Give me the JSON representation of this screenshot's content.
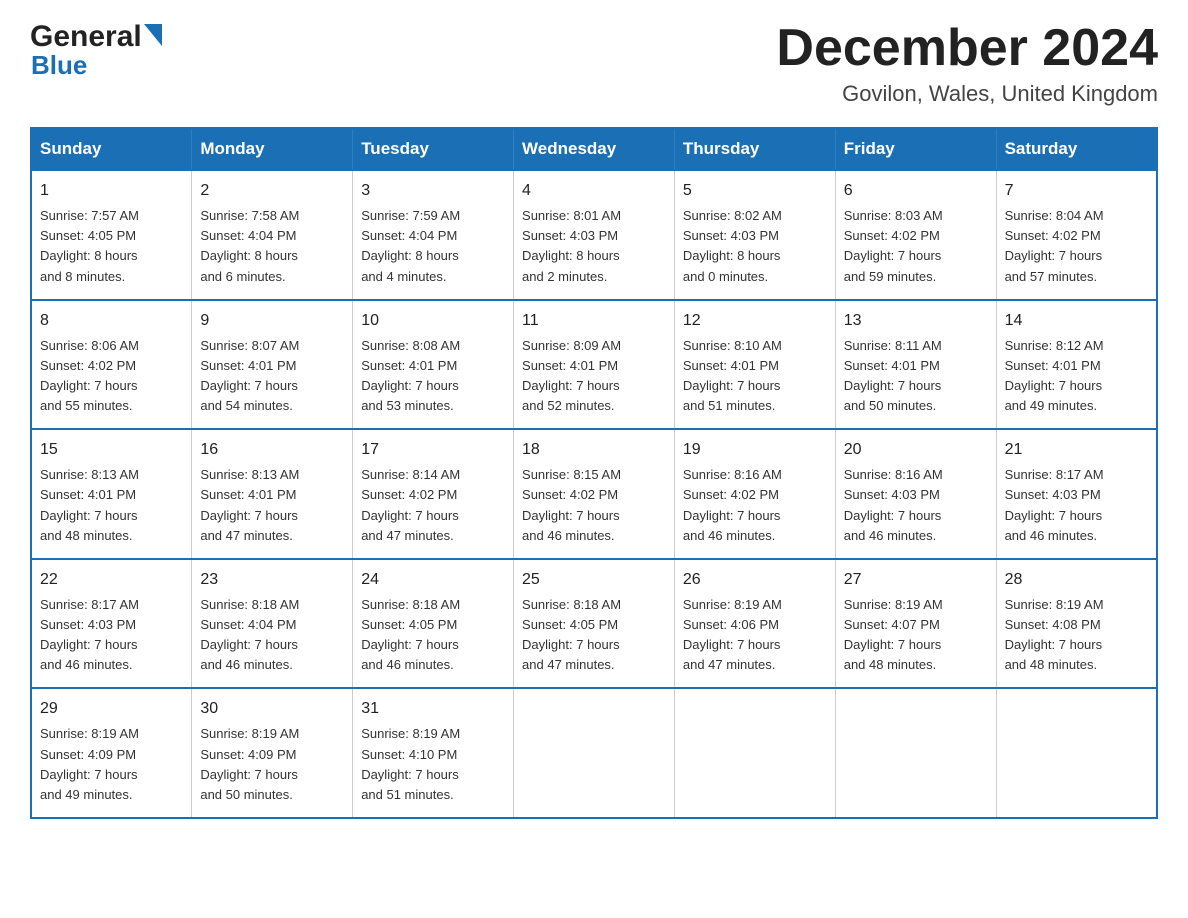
{
  "header": {
    "month_title": "December 2024",
    "location": "Govilon, Wales, United Kingdom",
    "logo_general": "General",
    "logo_blue": "Blue"
  },
  "weekdays": [
    "Sunday",
    "Monday",
    "Tuesday",
    "Wednesday",
    "Thursday",
    "Friday",
    "Saturday"
  ],
  "weeks": [
    [
      {
        "day": "1",
        "info": "Sunrise: 7:57 AM\nSunset: 4:05 PM\nDaylight: 8 hours\nand 8 minutes."
      },
      {
        "day": "2",
        "info": "Sunrise: 7:58 AM\nSunset: 4:04 PM\nDaylight: 8 hours\nand 6 minutes."
      },
      {
        "day": "3",
        "info": "Sunrise: 7:59 AM\nSunset: 4:04 PM\nDaylight: 8 hours\nand 4 minutes."
      },
      {
        "day": "4",
        "info": "Sunrise: 8:01 AM\nSunset: 4:03 PM\nDaylight: 8 hours\nand 2 minutes."
      },
      {
        "day": "5",
        "info": "Sunrise: 8:02 AM\nSunset: 4:03 PM\nDaylight: 8 hours\nand 0 minutes."
      },
      {
        "day": "6",
        "info": "Sunrise: 8:03 AM\nSunset: 4:02 PM\nDaylight: 7 hours\nand 59 minutes."
      },
      {
        "day": "7",
        "info": "Sunrise: 8:04 AM\nSunset: 4:02 PM\nDaylight: 7 hours\nand 57 minutes."
      }
    ],
    [
      {
        "day": "8",
        "info": "Sunrise: 8:06 AM\nSunset: 4:02 PM\nDaylight: 7 hours\nand 55 minutes."
      },
      {
        "day": "9",
        "info": "Sunrise: 8:07 AM\nSunset: 4:01 PM\nDaylight: 7 hours\nand 54 minutes."
      },
      {
        "day": "10",
        "info": "Sunrise: 8:08 AM\nSunset: 4:01 PM\nDaylight: 7 hours\nand 53 minutes."
      },
      {
        "day": "11",
        "info": "Sunrise: 8:09 AM\nSunset: 4:01 PM\nDaylight: 7 hours\nand 52 minutes."
      },
      {
        "day": "12",
        "info": "Sunrise: 8:10 AM\nSunset: 4:01 PM\nDaylight: 7 hours\nand 51 minutes."
      },
      {
        "day": "13",
        "info": "Sunrise: 8:11 AM\nSunset: 4:01 PM\nDaylight: 7 hours\nand 50 minutes."
      },
      {
        "day": "14",
        "info": "Sunrise: 8:12 AM\nSunset: 4:01 PM\nDaylight: 7 hours\nand 49 minutes."
      }
    ],
    [
      {
        "day": "15",
        "info": "Sunrise: 8:13 AM\nSunset: 4:01 PM\nDaylight: 7 hours\nand 48 minutes."
      },
      {
        "day": "16",
        "info": "Sunrise: 8:13 AM\nSunset: 4:01 PM\nDaylight: 7 hours\nand 47 minutes."
      },
      {
        "day": "17",
        "info": "Sunrise: 8:14 AM\nSunset: 4:02 PM\nDaylight: 7 hours\nand 47 minutes."
      },
      {
        "day": "18",
        "info": "Sunrise: 8:15 AM\nSunset: 4:02 PM\nDaylight: 7 hours\nand 46 minutes."
      },
      {
        "day": "19",
        "info": "Sunrise: 8:16 AM\nSunset: 4:02 PM\nDaylight: 7 hours\nand 46 minutes."
      },
      {
        "day": "20",
        "info": "Sunrise: 8:16 AM\nSunset: 4:03 PM\nDaylight: 7 hours\nand 46 minutes."
      },
      {
        "day": "21",
        "info": "Sunrise: 8:17 AM\nSunset: 4:03 PM\nDaylight: 7 hours\nand 46 minutes."
      }
    ],
    [
      {
        "day": "22",
        "info": "Sunrise: 8:17 AM\nSunset: 4:03 PM\nDaylight: 7 hours\nand 46 minutes."
      },
      {
        "day": "23",
        "info": "Sunrise: 8:18 AM\nSunset: 4:04 PM\nDaylight: 7 hours\nand 46 minutes."
      },
      {
        "day": "24",
        "info": "Sunrise: 8:18 AM\nSunset: 4:05 PM\nDaylight: 7 hours\nand 46 minutes."
      },
      {
        "day": "25",
        "info": "Sunrise: 8:18 AM\nSunset: 4:05 PM\nDaylight: 7 hours\nand 47 minutes."
      },
      {
        "day": "26",
        "info": "Sunrise: 8:19 AM\nSunset: 4:06 PM\nDaylight: 7 hours\nand 47 minutes."
      },
      {
        "day": "27",
        "info": "Sunrise: 8:19 AM\nSunset: 4:07 PM\nDaylight: 7 hours\nand 48 minutes."
      },
      {
        "day": "28",
        "info": "Sunrise: 8:19 AM\nSunset: 4:08 PM\nDaylight: 7 hours\nand 48 minutes."
      }
    ],
    [
      {
        "day": "29",
        "info": "Sunrise: 8:19 AM\nSunset: 4:09 PM\nDaylight: 7 hours\nand 49 minutes."
      },
      {
        "day": "30",
        "info": "Sunrise: 8:19 AM\nSunset: 4:09 PM\nDaylight: 7 hours\nand 50 minutes."
      },
      {
        "day": "31",
        "info": "Sunrise: 8:19 AM\nSunset: 4:10 PM\nDaylight: 7 hours\nand 51 minutes."
      },
      null,
      null,
      null,
      null
    ]
  ]
}
